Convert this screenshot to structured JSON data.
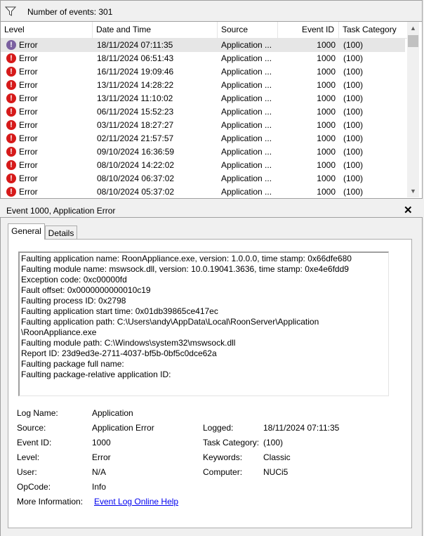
{
  "filterbar": {
    "count_text": "Number of events: 301"
  },
  "grid": {
    "columns": [
      "Level",
      "Date and Time",
      "Source",
      "Event ID",
      "Task Category"
    ],
    "rows": [
      {
        "level": "Error",
        "datetime": "18/11/2024 07:11:35",
        "source": "Application ...",
        "event_id": "1000",
        "category": "(100)"
      },
      {
        "level": "Error",
        "datetime": "18/11/2024 06:51:43",
        "source": "Application ...",
        "event_id": "1000",
        "category": "(100)"
      },
      {
        "level": "Error",
        "datetime": "16/11/2024 19:09:46",
        "source": "Application ...",
        "event_id": "1000",
        "category": "(100)"
      },
      {
        "level": "Error",
        "datetime": "13/11/2024 14:28:22",
        "source": "Application ...",
        "event_id": "1000",
        "category": "(100)"
      },
      {
        "level": "Error",
        "datetime": "13/11/2024 11:10:02",
        "source": "Application ...",
        "event_id": "1000",
        "category": "(100)"
      },
      {
        "level": "Error",
        "datetime": "06/11/2024 15:52:23",
        "source": "Application ...",
        "event_id": "1000",
        "category": "(100)"
      },
      {
        "level": "Error",
        "datetime": "03/11/2024 18:27:27",
        "source": "Application ...",
        "event_id": "1000",
        "category": "(100)"
      },
      {
        "level": "Error",
        "datetime": "02/11/2024 21:57:57",
        "source": "Application ...",
        "event_id": "1000",
        "category": "(100)"
      },
      {
        "level": "Error",
        "datetime": "09/10/2024 16:36:59",
        "source": "Application ...",
        "event_id": "1000",
        "category": "(100)"
      },
      {
        "level": "Error",
        "datetime": "08/10/2024 14:22:02",
        "source": "Application ...",
        "event_id": "1000",
        "category": "(100)"
      },
      {
        "level": "Error",
        "datetime": "08/10/2024 06:37:02",
        "source": "Application ...",
        "event_id": "1000",
        "category": "(100)"
      },
      {
        "level": "Error",
        "datetime": "08/10/2024 05:37:02",
        "source": "Application ...",
        "event_id": "1000",
        "category": "(100)"
      }
    ]
  },
  "detail": {
    "title": "Event 1000, Application Error",
    "tabs": [
      "General",
      "Details"
    ],
    "message_lines": [
      "Faulting application name: RoonAppliance.exe, version: 1.0.0.0, time stamp: 0x66dfe680",
      "Faulting module name: mswsock.dll, version: 10.0.19041.3636, time stamp: 0xe4e6fdd9",
      "Exception code: 0xc00000fd",
      "Fault offset: 0x0000000000010c19",
      "Faulting process ID: 0x2798",
      "Faulting application start time: 0x01db39865ce417ec",
      "Faulting application path: C:\\Users\\andy\\AppData\\Local\\RoonServer\\Application",
      "\\RoonAppliance.exe",
      "Faulting module path: C:\\Windows\\system32\\mswsock.dll",
      "Report ID: 23d9ed3e-2711-4037-bf5b-0bf5c0dce62a",
      "Faulting package full name:",
      "Faulting package-relative application ID:"
    ],
    "fields": {
      "log_name_label": "Log Name:",
      "log_name": "Application",
      "source_label": "Source:",
      "source": "Application Error",
      "logged_label": "Logged:",
      "logged": "18/11/2024 07:11:35",
      "event_id_label": "Event ID:",
      "event_id": "1000",
      "task_category_label": "Task Category:",
      "task_category": "(100)",
      "level_label": "Level:",
      "level": "Error",
      "keywords_label": "Keywords:",
      "keywords": "Classic",
      "user_label": "User:",
      "user": "N/A",
      "computer_label": "Computer:",
      "computer": "NUCi5",
      "opcode_label": "OpCode:",
      "opcode": "Info",
      "more_info_label": "More Information:",
      "more_info_link": "Event Log Online Help"
    }
  },
  "colors": {
    "error_red": "#d61a1a",
    "selected_row": "#e6e6e6",
    "link_blue": "#0000ee"
  }
}
